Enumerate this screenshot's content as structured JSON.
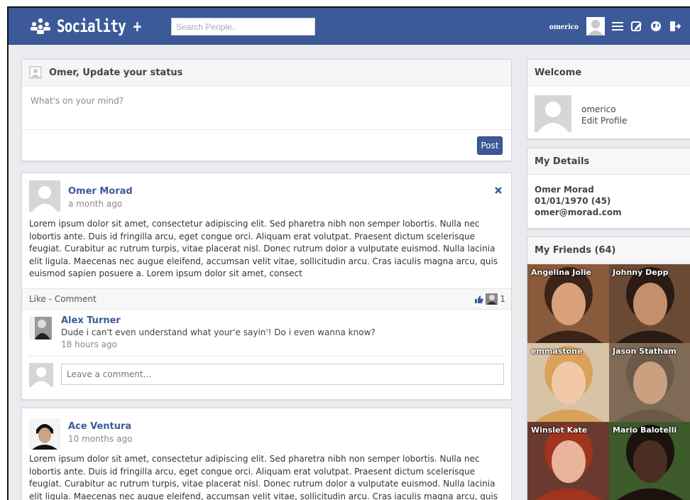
{
  "app": {
    "name": "Sociality +",
    "accent": "#3c5a99"
  },
  "navbar": {
    "search_placeholder": "Search People..",
    "username": "omerico",
    "icons": [
      "list-icon",
      "edit-icon",
      "globe-icon",
      "logout-icon"
    ]
  },
  "status": {
    "title": "Omer, Update your status",
    "placeholder": "What's on your mind?",
    "post_label": "Post"
  },
  "posts": [
    {
      "author": "Omer Morad",
      "time": "a month ago",
      "text": "Lorem ipsum dolor sit amet, consectetur adipiscing elit. Sed pharetra nibh non semper lobortis. Nulla nec lobortis ante. Duis id fringilla arcu, eget congue orci. Aliquam erat volutpat. Praesent dictum scelerisque feugiat. Curabitur ac rutrum turpis, vitae placerat nisl. Donec rutrum dolor a vulputate euismod. Nulla lacinia elit ligula. Maecenas nec augue eleifend, accumsan velit vitae, sollicitudin arcu. Cras iaculis magna arcu, quis euismod sapien posuere a. Lorem ipsum dolor sit amet, consect",
      "actions": "Like - Comment",
      "like_count": "1",
      "comment": {
        "author": "Alex Turner",
        "text": "Dude i can't even understand what your'e sayin'! Do i even wanna know?",
        "time": "18 hours ago"
      },
      "comment_placeholder": "Leave a comment..."
    },
    {
      "author": "Ace Ventura",
      "time": "10 months ago",
      "text": "Lorem ipsum dolor sit amet, consectetur adipiscing elit. Sed pharetra nibh non semper lobortis. Nulla nec lobortis ante. Duis id fringilla arcu, eget congue orci. Aliquam erat volutpat. Praesent dictum scelerisque feugiat. Curabitur ac rutrum turpis, vitae placerat nisl. Donec rutrum dolor a vulputate euismod. Nulla lacinia elit ligula. Maecenas nec augue eleifend, accumsan velit vitae, sollicitudin arcu. Cras iaculis magna arcu, quis"
    }
  ],
  "welcome": {
    "title": "Welcome",
    "username": "omerico",
    "edit_label": "Edit Profile"
  },
  "details": {
    "title": "My Details",
    "name": "Omer Morad",
    "birth": "01/01/1970 (45)",
    "email": "omer@morad.com"
  },
  "friends": {
    "title": "My Friends (64)",
    "list": [
      {
        "name": "Angelina Jolie",
        "bg": "#8a5a3c",
        "skin": "#d9a27a",
        "hair": "#3b2418"
      },
      {
        "name": "Johnny Depp",
        "bg": "#6b4a35",
        "skin": "#c58f6b",
        "hair": "#2a1c14"
      },
      {
        "name": "emmastone",
        "bg": "#d7c3a6",
        "skin": "#f2c9a8",
        "hair": "#d9a25a"
      },
      {
        "name": "Jason Statham",
        "bg": "#7f6a55",
        "skin": "#caa080",
        "hair": "#6b5a48"
      },
      {
        "name": "Winslet Kate",
        "bg": "#6a3a2e",
        "skin": "#e8b49a",
        "hair": "#a0341f"
      },
      {
        "name": "Mario Balotelli",
        "bg": "#3d5a2a",
        "skin": "#4a2e22",
        "hair": "#1b120e"
      }
    ]
  }
}
